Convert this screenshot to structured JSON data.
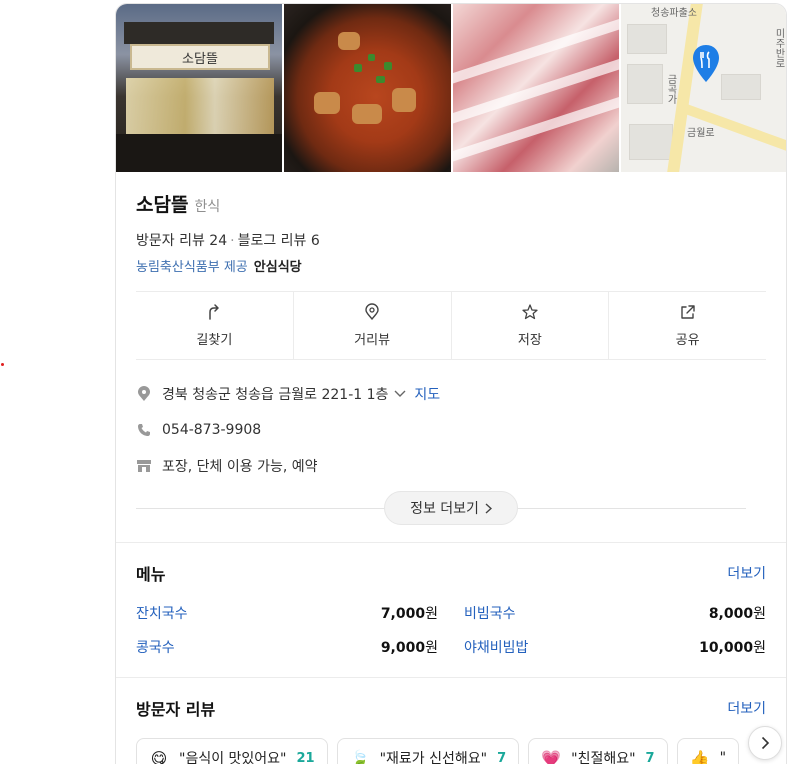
{
  "place": {
    "name": "소담뜰",
    "category": "한식",
    "visitor_reviews": "방문자 리뷰 24",
    "blog_reviews": "블로그 리뷰 6",
    "cert_text": "농림축산식품부 제공",
    "cert_badge": "안심식당"
  },
  "photos": {
    "sign_text": "소담뜰",
    "map_labels": [
      "청송파출소",
      "금월로",
      "금곡가",
      "미주반로"
    ]
  },
  "actions": [
    {
      "label": "길찾기",
      "icon": "directions-icon"
    },
    {
      "label": "거리뷰",
      "icon": "street-view-icon"
    },
    {
      "label": "저장",
      "icon": "star-icon"
    },
    {
      "label": "공유",
      "icon": "share-icon"
    }
  ],
  "info": {
    "address": "경북 청송군 청송읍 금월로 221-1 1층",
    "map_link": "지도",
    "phone": "054-873-9908",
    "amenities": "포장, 단체 이용 가능, 예약",
    "more_info": "정보 더보기"
  },
  "menu": {
    "title": "메뉴",
    "more": "더보기",
    "items": [
      {
        "name": "잔치국수",
        "price": "7,000",
        "unit": "원"
      },
      {
        "name": "비빔국수",
        "price": "8,000",
        "unit": "원"
      },
      {
        "name": "콩국수",
        "price": "9,000",
        "unit": "원"
      },
      {
        "name": "야채비빔밥",
        "price": "10,000",
        "unit": "원"
      }
    ]
  },
  "visitor_review": {
    "title": "방문자 리뷰",
    "more": "더보기",
    "chips": [
      {
        "text": "\"음식이 맛있어요\"",
        "count": "21",
        "emoji": "😋"
      },
      {
        "text": "\"재료가 신선해요\"",
        "count": "7",
        "emoji": "🍃"
      },
      {
        "text": "\"친절해요\"",
        "count": "7",
        "emoji": "💗"
      },
      {
        "text": "\"",
        "count": "",
        "emoji": "👍"
      }
    ]
  },
  "colors": {
    "link": "#2461bd",
    "count": "#1aa89a",
    "pin": "#1e7ee6"
  }
}
